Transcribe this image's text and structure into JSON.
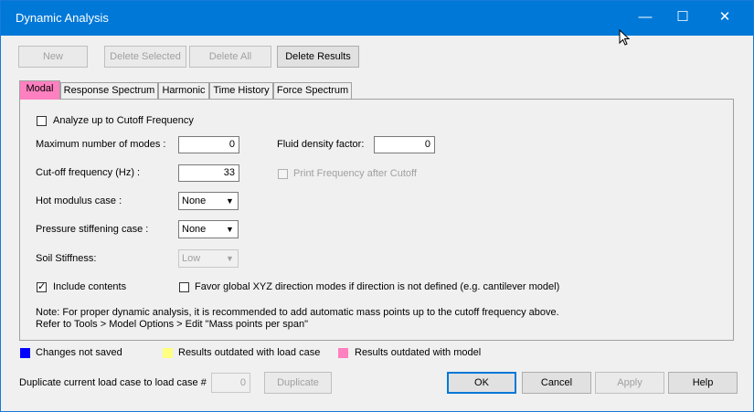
{
  "window": {
    "title": "Dynamic Analysis"
  },
  "toolbar": {
    "new_label": "New",
    "delete_selected_label": "Delete Selected",
    "delete_all_label": "Delete All",
    "delete_results_label": "Delete Results"
  },
  "tabs": [
    "Modal",
    "Response Spectrum",
    "Harmonic",
    "Time History",
    "Force Spectrum"
  ],
  "modal": {
    "analyze_cutoff_label": "Analyze up to Cutoff Frequency",
    "analyze_cutoff_checked": false,
    "max_modes_label": "Maximum number of modes :",
    "max_modes_value": "0",
    "fluid_density_label": "Fluid density factor:",
    "fluid_density_value": "0",
    "cutoff_freq_label": "Cut-off frequency (Hz) :",
    "cutoff_freq_value": "33",
    "print_freq_label": "Print Frequency after Cutoff",
    "hot_modulus_label": "Hot modulus case :",
    "hot_modulus_value": "None",
    "pressure_stiff_label": "Pressure stiffening case :",
    "pressure_stiff_value": "None",
    "soil_stiffness_label": "Soil Stiffness:",
    "soil_stiffness_value": "Low",
    "include_contents_label": "Include contents",
    "include_contents_checked": true,
    "favor_global_label": "Favor global XYZ direction modes if direction is not defined (e.g. cantilever model)",
    "note_line1": "Note: For proper dynamic analysis, it is recommended to add automatic mass points up to the cutoff frequency above.",
    "note_line2": "Refer to Tools > Model Options > Edit \"Mass points per span\""
  },
  "legend": [
    {
      "label": "Changes not saved",
      "color": "#0000ff"
    },
    {
      "label": "Results outdated with load case",
      "color": "#ffff80"
    },
    {
      "label": "Results outdated with model",
      "color": "#ff80c0"
    }
  ],
  "footer": {
    "duplicate_label": "Duplicate current load case to load case #",
    "duplicate_value": "0",
    "duplicate_button": "Duplicate",
    "ok": "OK",
    "cancel": "Cancel",
    "apply": "Apply",
    "help": "Help"
  }
}
